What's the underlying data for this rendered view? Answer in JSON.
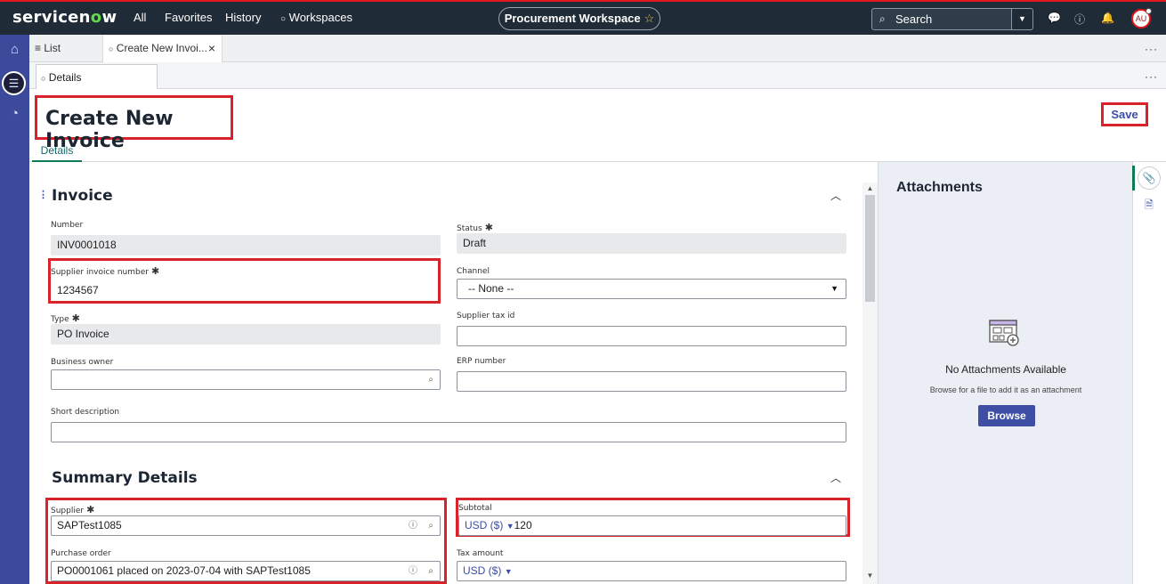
{
  "topbar": {
    "logo_a": "servicen",
    "logo_o": "o",
    "logo_b": "w",
    "nav": [
      "All",
      "Favorites",
      "History",
      "Workspaces"
    ],
    "workspace_pill": "Procurement Workspace",
    "search_label": "Search",
    "avatar_initials": "AU"
  },
  "tabs": {
    "list_label": "List",
    "current_label": "Create New Invoi...",
    "close": "×",
    "subtab_label": "Details",
    "more": "···"
  },
  "header": {
    "title": "Create New Invoice",
    "save_label": "Save",
    "details_tab": "Details"
  },
  "invoice": {
    "section_title": "Invoice",
    "number_label": "Number",
    "number_value": "INV0001018",
    "status_label": "Status",
    "status_value": "Draft",
    "supplier_invoice_label": "Supplier invoice number",
    "supplier_invoice_value": "1234567",
    "channel_label": "Channel",
    "channel_value": "-- None --",
    "type_label": "Type",
    "type_value": "PO Invoice",
    "supplier_tax_label": "Supplier tax id",
    "supplier_tax_value": "",
    "business_owner_label": "Business owner",
    "business_owner_value": "",
    "erp_label": "ERP number",
    "erp_value": "",
    "short_desc_label": "Short description",
    "short_desc_value": ""
  },
  "summary": {
    "section_title": "Summary Details",
    "supplier_label": "Supplier",
    "supplier_value": "SAPTest1085",
    "subtotal_label": "Subtotal",
    "subtotal_currency": "USD ($)",
    "subtotal_value": "120",
    "po_label": "Purchase order",
    "po_value": "PO0001061 placed on 2023-07-04 with SAPTest1085",
    "tax_label": "Tax amount",
    "tax_currency": "USD ($)"
  },
  "attachments": {
    "title": "Attachments",
    "empty_title": "No Attachments Available",
    "hint": "Browse for a file to add it as an attachment",
    "browse_label": "Browse"
  },
  "colors": {
    "topbar": "#1f2b37",
    "rail": "#3b4a9a",
    "highlight": "#d8232a",
    "accent": "#3f4ea5",
    "tab_active": "#0f7b52"
  }
}
